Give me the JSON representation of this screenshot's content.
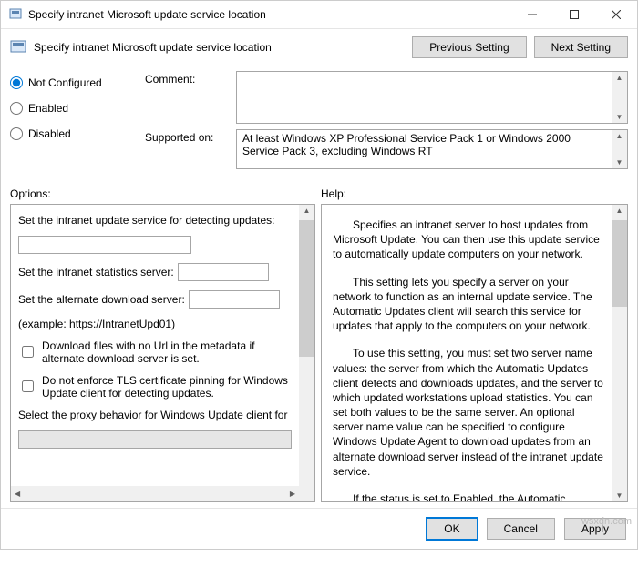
{
  "titlebar": {
    "title": "Specify intranet Microsoft update service location"
  },
  "subheader": {
    "title": "Specify intranet Microsoft update service location",
    "prev_label": "Previous Setting",
    "next_label": "Next Setting"
  },
  "radios": {
    "not_configured": "Not Configured",
    "enabled": "Enabled",
    "disabled": "Disabled"
  },
  "comment": {
    "label": "Comment:",
    "value": ""
  },
  "supported": {
    "label": "Supported on:",
    "text": "At least Windows XP Professional Service Pack 1 or Windows 2000 Service Pack 3, excluding Windows RT"
  },
  "panes": {
    "options_label": "Options:",
    "help_label": "Help:"
  },
  "options": {
    "detect_label": "Set the intranet update service for detecting updates:",
    "detect_value": "",
    "stats_label": "Set the intranet statistics server:",
    "stats_value": "",
    "alt_label": "Set the alternate download server:",
    "alt_value": "",
    "example": "(example: https://IntranetUpd01)",
    "cb_download": "Download files with no Url in the metadata if alternate download server is set.",
    "cb_tls": "Do not enforce TLS certificate pinning for Windows Update client for detecting updates.",
    "proxy_label": "Select the proxy behavior for Windows Update client for",
    "proxy_value": ""
  },
  "help": {
    "p1": "Specifies an intranet server to host updates from Microsoft Update. You can then use this update service to automatically update computers on your network.",
    "p2": "This setting lets you specify a server on your network to function as an internal update service. The Automatic Updates client will search this service for updates that apply to the computers on your network.",
    "p3": "To use this setting, you must set two server name values: the server from which the Automatic Updates client detects and downloads updates, and the server to which updated workstations upload statistics. You can set both values to be the same server. An optional server name value can be specified to configure Windows Update Agent to download updates from an alternate download server instead of the intranet update service.",
    "p4": "If the status is set to Enabled, the Automatic Updates client connects to the specified intranet Microsoft update service (or alternate download server), instead of Windows Update, to"
  },
  "footer": {
    "ok": "OK",
    "cancel": "Cancel",
    "apply": "Apply"
  },
  "watermark": "wsxdn.com"
}
